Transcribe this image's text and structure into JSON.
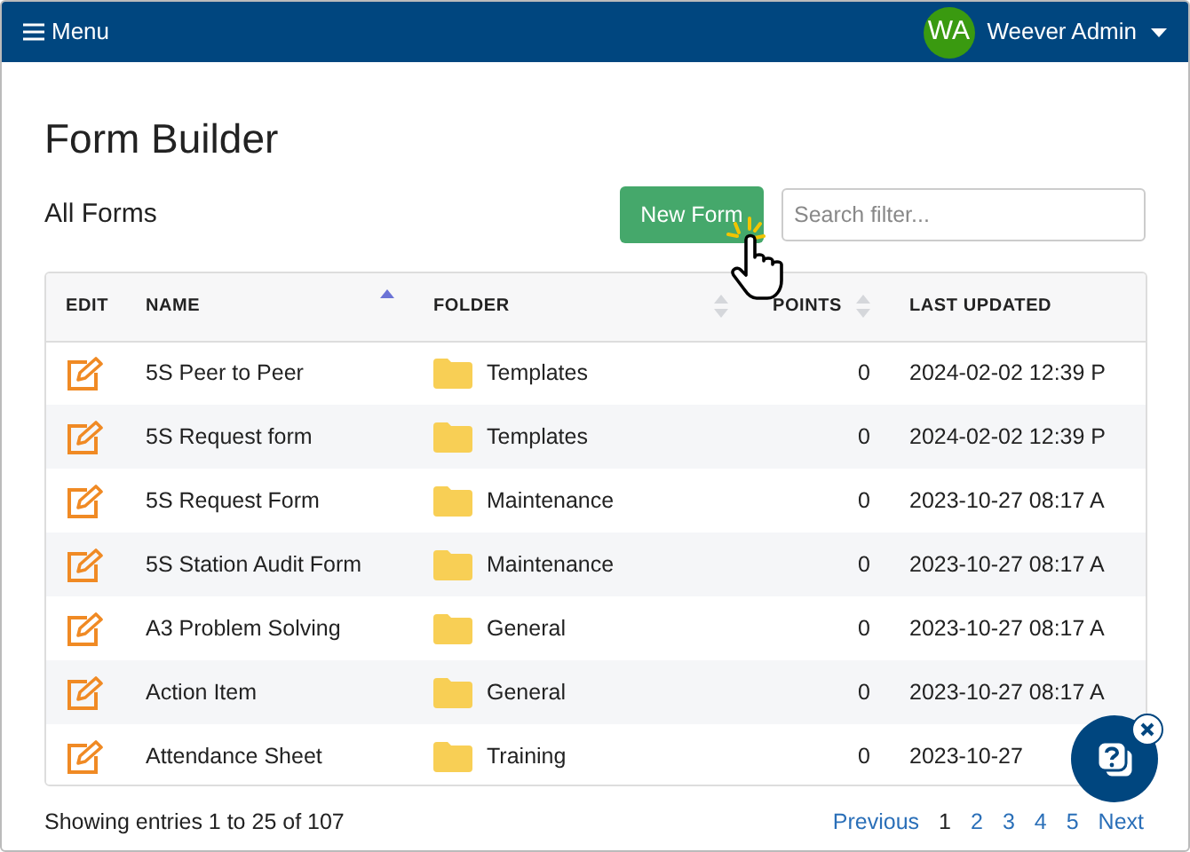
{
  "navbar": {
    "menu_label": "Menu",
    "user_initials": "WA",
    "user_name": "Weever Admin"
  },
  "page_title": "Form Builder",
  "section_title": "All Forms",
  "new_form_button": "New Form",
  "search": {
    "placeholder": "Search filter..."
  },
  "table": {
    "columns": [
      {
        "label": "EDIT"
      },
      {
        "label": "NAME",
        "sortable": true,
        "sorted_ascending": true
      },
      {
        "label": "FOLDER",
        "sortable": true,
        "sorted_ascending": false
      },
      {
        "label": "POINTS",
        "sortable": true,
        "sorted_ascending": false
      },
      {
        "label": "LAST UPDATED"
      }
    ],
    "rows": [
      {
        "name": "5S Peer to Peer",
        "folder": "Templates",
        "points": "0",
        "last_updated": "2024-02-02 12:39 P"
      },
      {
        "name": "5S Request form",
        "folder": "Templates",
        "points": "0",
        "last_updated": "2024-02-02 12:39 P"
      },
      {
        "name": "5S Request Form",
        "folder": "Maintenance",
        "points": "0",
        "last_updated": "2023-10-27 08:17 A"
      },
      {
        "name": "5S Station Audit Form",
        "folder": "Maintenance",
        "points": "0",
        "last_updated": "2023-10-27 08:17 A"
      },
      {
        "name": "A3 Problem Solving",
        "folder": "General",
        "points": "0",
        "last_updated": "2023-10-27 08:17 A"
      },
      {
        "name": "Action Item",
        "folder": "General",
        "points": "0",
        "last_updated": "2023-10-27 08:17 A"
      },
      {
        "name": "Attendance Sheet",
        "folder": "Training",
        "points": "0",
        "last_updated": "2023-10-27"
      }
    ]
  },
  "footer": {
    "entries_info": "Showing entries 1 to 25 of 107",
    "pagination": [
      {
        "label": "Previous",
        "selected": false
      },
      {
        "label": "1",
        "selected": true
      },
      {
        "label": "2",
        "selected": false
      },
      {
        "label": "3",
        "selected": false
      },
      {
        "label": "4",
        "selected": false
      },
      {
        "label": "5",
        "selected": false
      },
      {
        "label": "Next",
        "selected": false
      }
    ]
  }
}
